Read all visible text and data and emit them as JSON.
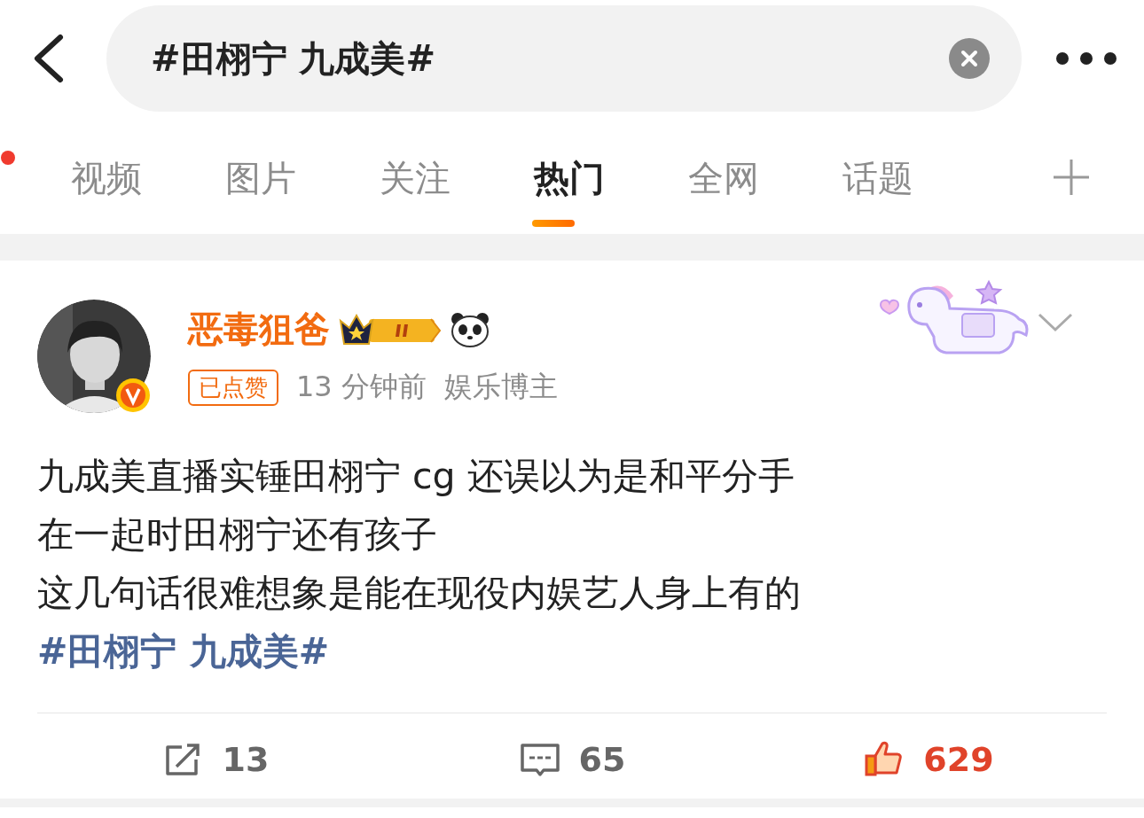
{
  "search": {
    "value": "#田栩宁 九成美#"
  },
  "tabs": [
    {
      "label": "视频",
      "selected": false
    },
    {
      "label": "图片",
      "selected": false
    },
    {
      "label": "关注",
      "selected": false
    },
    {
      "label": "热门",
      "selected": true
    },
    {
      "label": "全网",
      "selected": false
    },
    {
      "label": "话题",
      "selected": false
    }
  ],
  "post": {
    "author": "恶毒狙爸",
    "liked_tag": "已点赞",
    "time": "13 分钟前",
    "category": "娱乐博主",
    "lines": [
      "九成美直播实锤田栩宁 cg 还误以为是和平分手",
      "在一起时田栩宁还有孩子",
      "这几句话很难想象是能在现役内娱艺人身上有的"
    ],
    "hashtag": "#田栩宁 九成美#",
    "actions": [
      {
        "kind": "repost",
        "count": "13",
        "selected": false
      },
      {
        "kind": "comment",
        "count": "65",
        "selected": false
      },
      {
        "kind": "like",
        "count": "629",
        "selected": true
      }
    ]
  }
}
